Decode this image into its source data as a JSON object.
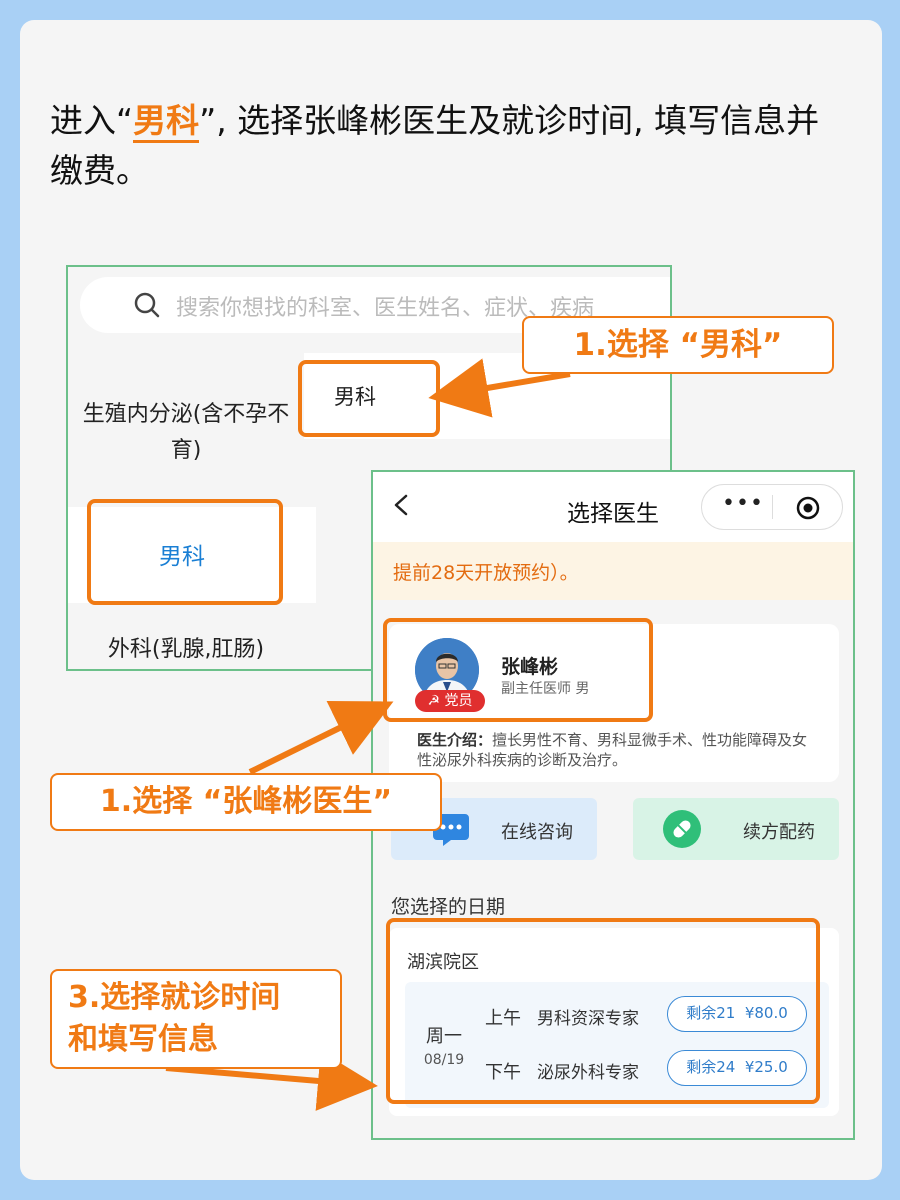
{
  "intro": {
    "prefix": "进入“",
    "highlight": "男科",
    "suffix": "”, 选择张峰彬医生及就诊时间, 填写信息并缴费。"
  },
  "screen1": {
    "search_placeholder": "搜索你想找的科室、医生姓名、症状、疾病",
    "right_item": "男科",
    "left_items": [
      "生殖内分泌(含不孕不育)",
      "男科",
      "外科(乳腺,肛肠)"
    ]
  },
  "callouts": {
    "step1a": "1.选择 “男科”",
    "step1b": "1.选择 “张峰彬医生”",
    "step3_line1": "3.选择就诊时间",
    "step3_line2": "和填写信息"
  },
  "screen2": {
    "nav_title": "选择医生",
    "capsule_dots": "•••",
    "notice": "提前28天开放预约）。",
    "doctor": {
      "name": "张峰彬",
      "title": "副主任医师 男",
      "badge": "党员",
      "intro_label": "医生介绍：",
      "intro_text": "擅长男性不育、男科显微手术、性功能障碍及女性泌尿外科疾病的诊断及治疗。"
    },
    "services": [
      "在线咨询",
      "续方配药"
    ],
    "date_label": "您选择的日期",
    "campus": "湖滨院区",
    "day": {
      "weekday": "周一",
      "date": "08/19"
    },
    "slots": [
      {
        "period": "上午",
        "type": "男科资深专家",
        "remain": "剩余21",
        "price": "¥80.0"
      },
      {
        "period": "下午",
        "type": "泌尿外科专家",
        "remain": "剩余24",
        "price": "¥25.0"
      }
    ]
  },
  "colors": {
    "accent": "#f07a14",
    "link": "#1a7fd4",
    "frame": "#6cc08a",
    "background": "#a9d0f5"
  }
}
